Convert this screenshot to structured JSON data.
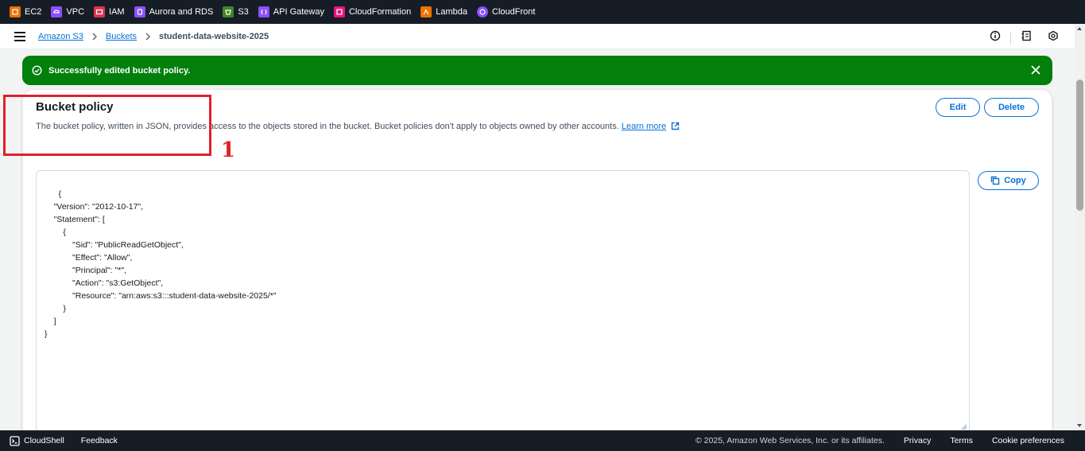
{
  "services": [
    {
      "label": "EC2",
      "color": "#ed7100",
      "icon": "ec2-icon"
    },
    {
      "label": "VPC",
      "color": "#8c4fff",
      "icon": "vpc-icon"
    },
    {
      "label": "IAM",
      "color": "#dd344c",
      "icon": "iam-icon"
    },
    {
      "label": "Aurora and RDS",
      "color": "#8c4fff",
      "icon": "rds-icon"
    },
    {
      "label": "S3",
      "color": "#3f8624",
      "icon": "s3-icon"
    },
    {
      "label": "API Gateway",
      "color": "#8c4fff",
      "icon": "api-gateway-icon"
    },
    {
      "label": "CloudFormation",
      "color": "#e7157b",
      "icon": "cloudformation-icon"
    },
    {
      "label": "Lambda",
      "color": "#ed7100",
      "icon": "lambda-icon"
    },
    {
      "label": "CloudFront",
      "color": "#8c4fff",
      "icon": "cloudfront-icon"
    }
  ],
  "breadcrumb": {
    "items": [
      "Amazon S3",
      "Buckets"
    ],
    "current": "student-data-website-2025"
  },
  "flash": {
    "message": "Successfully edited bucket policy.",
    "color": "#037f0c"
  },
  "annotation": {
    "label": "1",
    "color": "#e0202a"
  },
  "policy": {
    "title": "Bucket policy",
    "description": "The bucket policy, written in JSON, provides access to the objects stored in the bucket. Bucket policies don't apply to objects owned by other accounts.",
    "learn_more": "Learn more",
    "edit_label": "Edit",
    "delete_label": "Delete",
    "copy_label": "Copy",
    "json": "{\n    \"Version\": \"2012-10-17\",\n    \"Statement\": [\n        {\n            \"Sid\": \"PublicReadGetObject\",\n            \"Effect\": \"Allow\",\n            \"Principal\": \"*\",\n            \"Action\": \"s3:GetObject\",\n            \"Resource\": \"arn:aws:s3:::student-data-website-2025/*\"\n        }\n    ]\n}"
  },
  "footer": {
    "cloudshell": "CloudShell",
    "feedback": "Feedback",
    "copyright": "© 2025, Amazon Web Services, Inc. or its affiliates.",
    "privacy": "Privacy",
    "terms": "Terms",
    "cookies": "Cookie preferences"
  },
  "accent": "#0972d3"
}
